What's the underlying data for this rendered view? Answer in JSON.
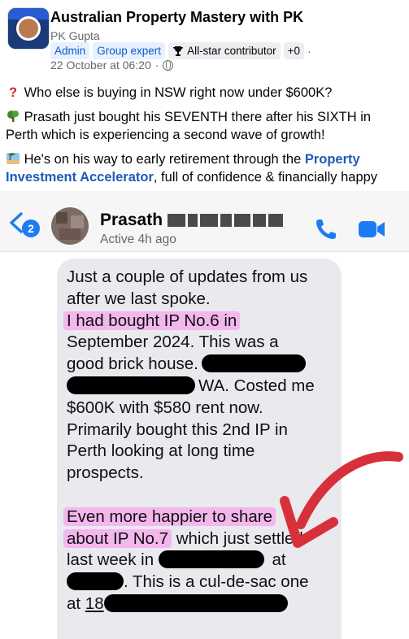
{
  "post": {
    "group_name": "Australian Property Mastery with PK",
    "author": "PK Gupta",
    "badge_admin": "Admin",
    "badge_group_expert": "Group expert",
    "badge_all_star": "All-star contributor",
    "badge_more": "+0",
    "separator": "·",
    "timestamp": "22 October at 06:20",
    "timestamp_sep": "·",
    "line1": "Who else is buying in NSW right now under $600K?",
    "line2": "Prasath just bought his SEVENTH there after his SIXTH in Perth which is experiencing a second wave of growth!",
    "line3_start": "He's on his way to early retirement through the ",
    "line3_link": "Property Investment Accelerator",
    "line3_end": ", full of confidence & financially happy"
  },
  "chat": {
    "unread_count": "2",
    "contact_name": "Prasath",
    "status": "Active 4h ago",
    "msg": {
      "l1": "Just a couple of updates from us",
      "l2": "after we last spoke.",
      "l3": "I had bought IP No.6 in",
      "l4": "September 2024. This was a",
      "l5": "good brick house.",
      "l6": "WA. Costed me",
      "l7": "$600K with $580 rent now.",
      "l8": "Primarily bought this 2nd IP in",
      "l9": "Perth looking at long time",
      "l10": "prospects.",
      "l11": "Even more happier to share",
      "l12a": "about IP No.7",
      "l12b": " which just settled",
      "l13a": "last week in ",
      "l13b": " at",
      "l14": ". This is a cul-de-sac one",
      "l15a": "at ",
      "l15b": "18"
    }
  },
  "colors": {
    "facebook_blue": "#1d5bb6",
    "messenger_blue": "#1e7cf2",
    "highlight_pink": "#f3b7ee",
    "arrow_red": "#d8303a"
  }
}
